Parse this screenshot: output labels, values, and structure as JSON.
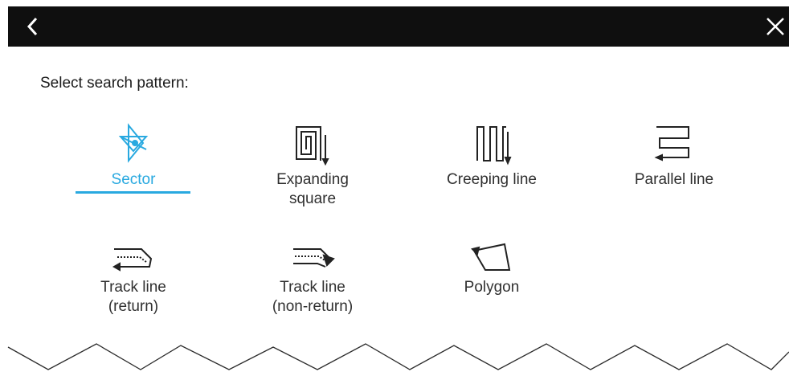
{
  "header": {
    "back_icon": "chevron-left-icon",
    "close_icon": "close-icon"
  },
  "panel": {
    "title": "Select search pattern:"
  },
  "patterns": [
    {
      "label": "Sector",
      "icon": "sector-pattern-icon",
      "selected": true
    },
    {
      "label": "Expanding\nsquare",
      "icon": "expanding-square-icon",
      "selected": false
    },
    {
      "label": "Creeping line",
      "icon": "creeping-line-icon",
      "selected": false
    },
    {
      "label": "Parallel line",
      "icon": "parallel-line-icon",
      "selected": false
    },
    {
      "label": "Track line\n(return)",
      "icon": "track-line-return-icon",
      "selected": false
    },
    {
      "label": "Track line\n(non-return)",
      "icon": "track-line-non-return-icon",
      "selected": false
    },
    {
      "label": "Polygon",
      "icon": "polygon-icon",
      "selected": false
    }
  ],
  "colors": {
    "topbar": "#0f0f0f",
    "accent": "#29a9e0",
    "text": "#303030"
  }
}
